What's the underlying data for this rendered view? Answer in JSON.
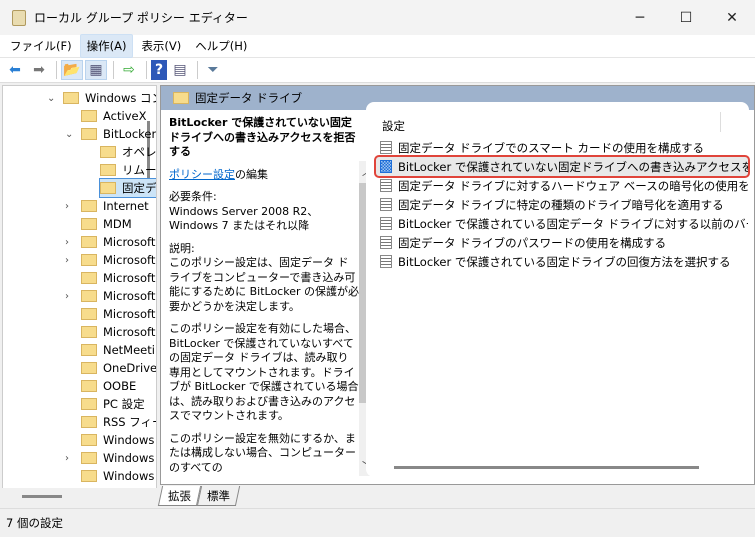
{
  "window": {
    "title": "ローカル グループ ポリシー エディター",
    "minimize": "─",
    "maximize": "☐",
    "close": "✕"
  },
  "menu": [
    "ファイル(F)",
    "操作(A)",
    "表示(V)",
    "ヘルプ(H)"
  ],
  "toolbar": {
    "icons": [
      "back-icon",
      "forward-icon",
      "up-folder-icon",
      "show-hide-tree-icon",
      "export-list-icon",
      "help-icon",
      "action-pane-icon",
      "filter-icon"
    ],
    "glyphs": [
      "⬅",
      "➡",
      "📂",
      "▦",
      "⇨",
      "?",
      "▤",
      "⏷"
    ]
  },
  "tree": [
    {
      "label": "Windows コンポーネント",
      "expanded": true,
      "level": 0
    },
    {
      "label": "ActiveX",
      "level": 1
    },
    {
      "label": "BitLocker",
      "expanded": true,
      "level": 1
    },
    {
      "label": "オペレーティング",
      "level": 2
    },
    {
      "label": "リムーバブル",
      "level": 2
    },
    {
      "label": "固定データ",
      "level": 2,
      "selected": true
    },
    {
      "label": "Internet",
      "level": 1,
      "expandable": true
    },
    {
      "label": "MDM",
      "level": 1
    },
    {
      "label": "Microsoft",
      "level": 1,
      "expandable": true
    },
    {
      "label": "Microsoft",
      "level": 1,
      "expandable": true
    },
    {
      "label": "Microsoft",
      "level": 1
    },
    {
      "label": "Microsoft",
      "level": 1,
      "expandable": true
    },
    {
      "label": "Microsoft",
      "level": 1
    },
    {
      "label": "Microsoft",
      "level": 1
    },
    {
      "label": "NetMeeting",
      "level": 1
    },
    {
      "label": "OneDrive",
      "level": 1
    },
    {
      "label": "OOBE",
      "level": 1
    },
    {
      "label": "PC 設定",
      "level": 1
    },
    {
      "label": "RSS フィード",
      "level": 1
    },
    {
      "label": "Windows",
      "level": 1
    },
    {
      "label": "Windows",
      "level": 1,
      "expandable": true
    },
    {
      "label": "Windows",
      "level": 1
    },
    {
      "label": "Windows",
      "level": 1
    }
  ],
  "pane": {
    "header": "固定データ ドライブ",
    "desc": {
      "title": "BitLocker で保護されていない固定ドライブへの書き込みアクセスを拒否する",
      "link": "ポリシー設定",
      "edit": "の編集",
      "req_label": "必要条件:",
      "req": "Windows Server 2008 R2、Windows 7 またはそれ以降",
      "exp_label": "説明:",
      "p1": "このポリシー設定は、固定データ ドライブをコンピューターで書き込み可能にするために BitLocker の保護が必要かどうかを決定します。",
      "p2": "このポリシー設定を有効にした場合、BitLocker で保護されていないすべての固定データ ドライブは、読み取り専用としてマウントされます。ドライブが BitLocker で保護されている場合は、読み取りおよび書き込みのアクセスでマウントされます。",
      "p3": "このポリシー設定を無効にするか、または構成しない場合、コンピューターのすべての"
    },
    "column": "設定",
    "rows": [
      "固定データ ドライブでのスマート カードの使用を構成する",
      "BitLocker で保護されていない固定ドライブへの書き込みアクセスを...",
      "固定データ ドライブに対するハードウェア ベースの暗号化の使用を構...",
      "固定データ ドライブに特定の種類のドライブ暗号化を適用する",
      "BitLocker で保護されている固定データ ドライブに対する以前のバー...",
      "固定データ ドライブのパスワードの使用を構成する",
      "BitLocker で保護されている固定ドライブの回復方法を選択する"
    ],
    "selected_row": 1,
    "tabs": [
      "拡張",
      "標準"
    ]
  },
  "status": "7 個の設定"
}
